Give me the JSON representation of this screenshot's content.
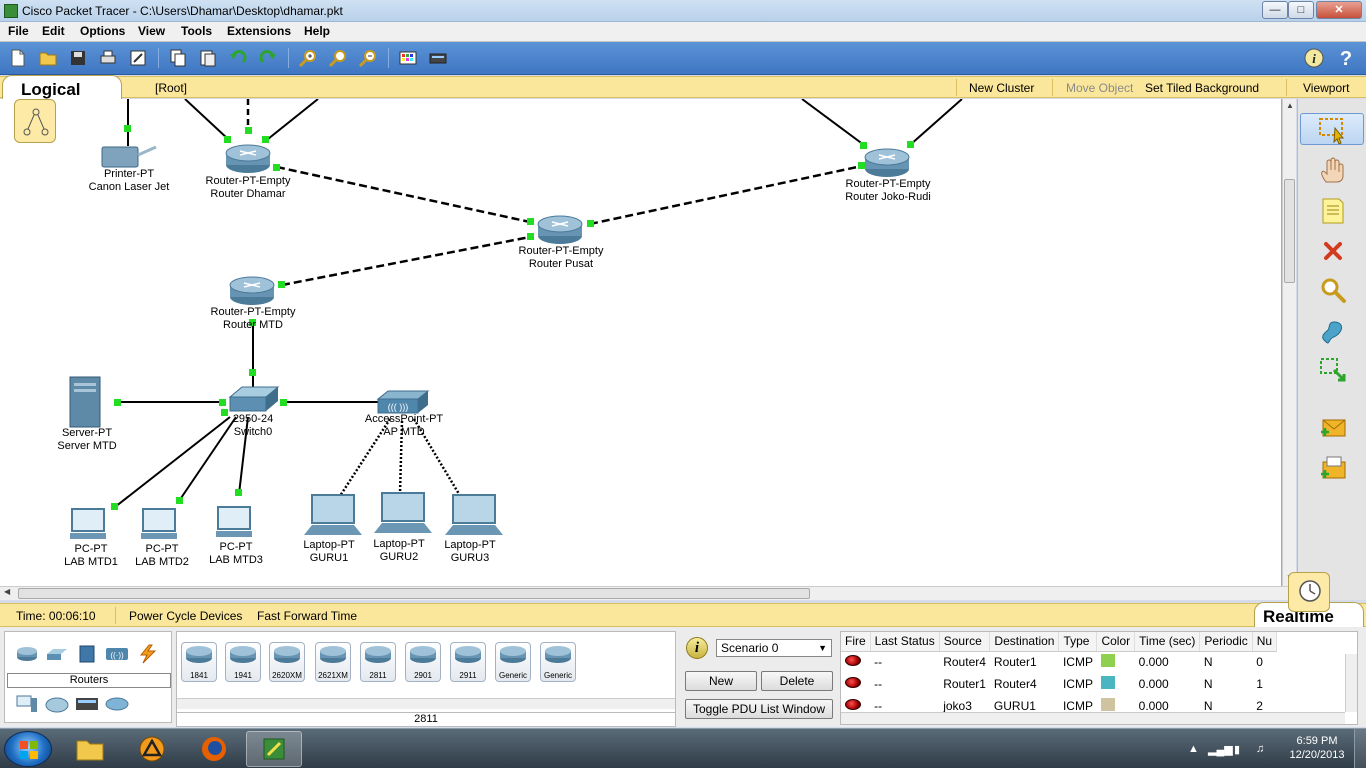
{
  "window": {
    "title": "Cisco Packet Tracer - C:\\Users\\Dhamar\\Desktop\\dhamar.pkt",
    "minimize_icon": "minimize-icon",
    "maximize_icon": "maximize-icon",
    "close_icon": "close-icon"
  },
  "menu": {
    "items": [
      "File",
      "Edit",
      "Options",
      "View",
      "Tools",
      "Extensions",
      "Help"
    ]
  },
  "logical_bar": {
    "tab_label": "Logical",
    "location": "[Root]",
    "new_cluster": "New Cluster",
    "move_object": "Move Object",
    "set_tiled_background": "Set Tiled Background",
    "viewport": "Viewport"
  },
  "devices": {
    "printer": {
      "type": "Printer-PT",
      "name": "Canon Laser Jet"
    },
    "router_dhamar": {
      "type": "Router-PT-Empty",
      "name": "Router Dhamar"
    },
    "router_joko": {
      "type": "Router-PT-Empty",
      "name": "Router Joko-Rudi"
    },
    "router_pusat": {
      "type": "Router-PT-Empty",
      "name": "Router Pusat"
    },
    "router_mtd": {
      "type": "Router-PT-Empty",
      "name": "Router MTD"
    },
    "server": {
      "type": "Server-PT",
      "name": "Server MTD"
    },
    "switch": {
      "type": "2950-24",
      "name": "Switch0"
    },
    "access_point": {
      "type": "AccessPoint-PT",
      "name": "AP MTD"
    },
    "pc1": {
      "type": "PC-PT",
      "name": "LAB MTD1"
    },
    "pc2": {
      "type": "PC-PT",
      "name": "LAB MTD2"
    },
    "pc3": {
      "type": "PC-PT",
      "name": "LAB MTD3"
    },
    "laptop1": {
      "type": "Laptop-PT",
      "name": "GURU1"
    },
    "laptop2": {
      "type": "Laptop-PT",
      "name": "GURU2"
    },
    "laptop3": {
      "type": "Laptop-PT",
      "name": "GURU3"
    }
  },
  "link_colors": {
    "link_up": "#22dd22",
    "link_line": "#000000"
  },
  "realtime_bar": {
    "time": "Time: 00:06:10",
    "power_cycle": "Power Cycle Devices",
    "fast_forward": "Fast Forward Time",
    "mode_label": "Realtime"
  },
  "device_panel": {
    "category_label": "Routers",
    "models": [
      "1841",
      "1941",
      "2620XM",
      "2621XM",
      "2811",
      "2901",
      "2911",
      "Generic",
      "Generic"
    ],
    "selected_model": "2811"
  },
  "scenario": {
    "info_icon": "info-icon",
    "selected": "Scenario 0",
    "new_label": "New",
    "delete_label": "Delete",
    "toggle_label": "Toggle PDU List Window"
  },
  "pdu_list": {
    "columns": [
      "Fire",
      "Last Status",
      "Source",
      "Destination",
      "Type",
      "Color",
      "Time (sec)",
      "Periodic",
      "Nu"
    ],
    "rows": [
      {
        "last_status": "--",
        "source": "Router4",
        "destination": "Router1",
        "type": "ICMP",
        "color": "#8fd14f",
        "time": "0.000",
        "periodic": "N",
        "num": "0"
      },
      {
        "last_status": "--",
        "source": "Router1",
        "destination": "Router4",
        "type": "ICMP",
        "color": "#49b6c2",
        "time": "0.000",
        "periodic": "N",
        "num": "1"
      },
      {
        "last_status": "--",
        "source": "joko3",
        "destination": "GURU1",
        "type": "ICMP",
        "color": "#cfc3a0",
        "time": "0.000",
        "periodic": "N",
        "num": "2"
      }
    ]
  },
  "taskbar": {
    "time": "6:59 PM",
    "date": "12/20/2013"
  },
  "colors": {
    "toolbar_blue": "#4a83cc",
    "mode_bar_yellow": "#fbe79b"
  }
}
